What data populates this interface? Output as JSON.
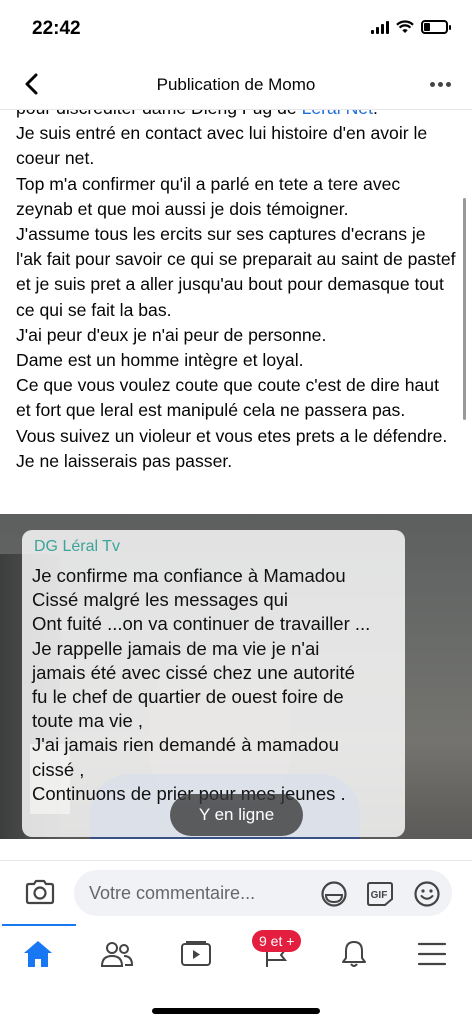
{
  "status": {
    "time": "22:42",
    "battery_level": 0.3
  },
  "header": {
    "title": "Publication de Momo"
  },
  "post": {
    "lines": [
      {
        "text": "pour discréditer dame Dieng Fug de ",
        "link": "Leral Net",
        "after": "."
      },
      {
        "text": "Je suis entré en contact avec lui histoire d'en avoir le coeur net."
      },
      {
        "text": "Top m'a confirmer qu'il a parlé en tete a tere avec zeynab et que moi aussi je dois témoigner."
      },
      {
        "text": "J'assume tous les ercits sur ses captures d'ecrans je l'ak fait pour savoir ce qui se preparait au saint de pastef et je suis pret a aller jusqu'au bout pour demasque tout ce qui se fait la bas."
      },
      {
        "text": "J'ai peur d'eux je n'ai peur de personne."
      },
      {
        "text": "Dame est un homme intègre et loyal."
      },
      {
        "text": "Ce que vous voulez coute que coute c'est de dire haut et fort que leral est manipulé cela ne passera pas."
      },
      {
        "text": "Vous suivez un violeur et vous etes prets a le défendre. Je ne laisserais pas passer."
      }
    ]
  },
  "image": {
    "sender": "DG Léral Tv",
    "message_lines": [
      "Je confirme ma confiance à Mamadou",
      "Cissé malgré  les messages qui",
      "Ont fuité ...on va continuer de travailler ...",
      "Je rappelle jamais de ma vie je n'ai",
      "jamais été avec cissé chez une autorité",
      "fu le chef de quartier de ouest foire de",
      "toute ma vie ,",
      "J'ai jamais rien demandé à mamadou",
      "cissé ,",
      "Continuons de prier pour mes jeunes ."
    ],
    "online_label": "Y en ligne"
  },
  "comment": {
    "placeholder": "Votre commentaire..."
  },
  "tabs": {
    "badge": "9 et +"
  },
  "colors": {
    "accent": "#1877f2",
    "badge": "#e41e3f",
    "link": "#216fdb",
    "sender": "#3ca49a"
  }
}
